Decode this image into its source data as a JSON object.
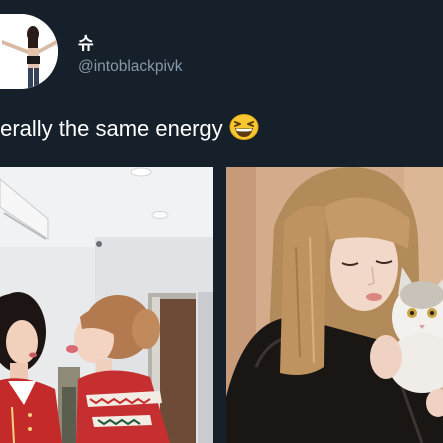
{
  "tweet": {
    "display_name": "슈",
    "handle": "@intoblackpivk",
    "text": "terally the same energy",
    "emoji": "grinning-squinting-face-icon"
  },
  "media": [
    {
      "name": "photo-left",
      "icon": "photo-icon"
    },
    {
      "name": "photo-right",
      "icon": "photo-icon"
    }
  ],
  "colors": {
    "background": "#15202b",
    "primary_text": "#ffffff",
    "secondary_text": "#8899a6"
  }
}
